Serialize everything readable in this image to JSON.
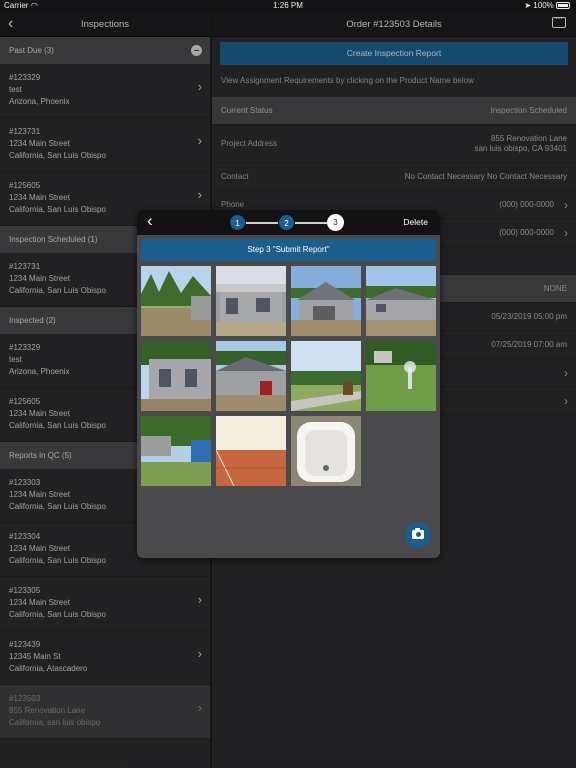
{
  "status_bar": {
    "carrier": "Carrier",
    "time": "1:26 PM",
    "battery": "100%"
  },
  "left": {
    "title": "Inspections",
    "sections": [
      {
        "label": "Past Due (3)",
        "items": [
          {
            "id": "#123329",
            "line2": "test",
            "line3": "Arizona, Phoenix"
          },
          {
            "id": "#123731",
            "line2": "1234 Main Street",
            "line3": "California, San Luis Obispo"
          },
          {
            "id": "#125605",
            "line2": "1234 Main Street",
            "line3": "California, San Luis Obispo"
          }
        ]
      },
      {
        "label": "Inspection Scheduled (1)",
        "items": [
          {
            "id": "#123731",
            "line2": "1234 Main Street",
            "line3": "California, San Luis Obispo"
          }
        ]
      },
      {
        "label": "Inspected (2)",
        "items": [
          {
            "id": "#123329",
            "line2": "test",
            "line3": "Arizona, Phoenix"
          },
          {
            "id": "#125605",
            "line2": "1234 Main Street",
            "line3": "California, San Luis Obispo"
          }
        ]
      },
      {
        "label": "Reports in QC (5)",
        "items": [
          {
            "id": "#123303",
            "line2": "1234 Main Street",
            "line3": "California, San Luis Obispo"
          },
          {
            "id": "#123304",
            "line2": "1234 Main Street",
            "line3": "California, San Luis Obispo"
          },
          {
            "id": "#123305",
            "line2": "1234 Main Street",
            "line3": "California, San Luis Obispo"
          },
          {
            "id": "#123439",
            "line2": "12345 Main St",
            "line3": "California, Atascadero"
          },
          {
            "id": "#123503",
            "line2": "855 Renovation Lane",
            "line3": "California, san luis obispo"
          }
        ]
      }
    ]
  },
  "right": {
    "title": "Order #123503 Details",
    "create_button": "Create Inspection Report",
    "requirements_text": "View Assignment Requirements by clicking on the Product Name below",
    "current_status_label": "Current Status",
    "current_status_value": "Inspection Scheduled",
    "project_address_label": "Project Address",
    "project_address_line1": "855 Renovation Lane",
    "project_address_line2": "san luis obispo, CA 93401",
    "contact_label": "Contact",
    "contact_value": "No Contact Necessary  No Contact Necessary",
    "phone_label": "Phone",
    "phone_value": "(000) 000-0000",
    "phone2_value": "(000) 000-0000",
    "none_value": "NONE",
    "date1": "05/23/2019 05:00 pm",
    "date2": "07/25/2019 07:00 am"
  },
  "modal": {
    "delete_label": "Delete",
    "steps": [
      "1",
      "2",
      "3"
    ],
    "current_step": 3,
    "banner": "Step 3 \"Submit Report\"",
    "photos": [
      "photo-site-clearing",
      "photo-house-porch",
      "photo-house-garage",
      "photo-house-side",
      "photo-house-front",
      "photo-house-corner",
      "photo-road-sign",
      "photo-sprinkler",
      "photo-porta-potty",
      "photo-bathroom-tile",
      "photo-bathtub"
    ]
  },
  "colors": {
    "accent": "#1b5e8e",
    "section_header": "#48484b",
    "background": "#2b2b2d"
  }
}
